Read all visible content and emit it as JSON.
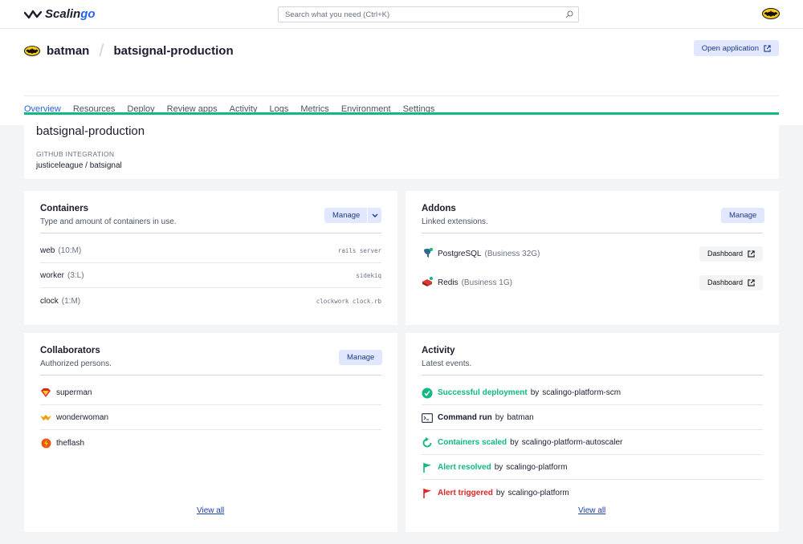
{
  "topbar": {
    "logo_text_a": "Scalin",
    "logo_text_b": "go",
    "search_placeholder": "Search what you need (Ctrl+K)"
  },
  "app": {
    "owner": "batman",
    "separator": "/",
    "name": "batsignal-production",
    "open_label": "Open application"
  },
  "nav": {
    "tabs": [
      "Overview",
      "Resources",
      "Deploy",
      "Review apps",
      "Activity",
      "Logs",
      "Metrics",
      "Environment",
      "Settings"
    ],
    "active": "Overview"
  },
  "hero": {
    "title": "batsignal-production",
    "integration_label": "GITHUB INTEGRATION",
    "integration_value": "justiceleague / batsignal"
  },
  "containers": {
    "title": "Containers",
    "subtitle": "Type and amount of containers in use.",
    "manage": "Manage",
    "rows": [
      {
        "name": "web",
        "size": "(10:M)",
        "cmd": "rails server"
      },
      {
        "name": "worker",
        "size": "(3:L)",
        "cmd": "sidekiq"
      },
      {
        "name": "clock",
        "size": "(1:M)",
        "cmd": "clockwork clock.rb"
      }
    ]
  },
  "addons": {
    "title": "Addons",
    "subtitle": "Linked extensions.",
    "manage": "Manage",
    "rows": [
      {
        "name": "PostgreSQL",
        "plan": "(Business 32G)",
        "action": "Dashboard",
        "icon": "postgresql-icon"
      },
      {
        "name": "Redis",
        "plan": "(Business 1G)",
        "action": "Dashboard",
        "icon": "redis-icon"
      }
    ]
  },
  "collaborators": {
    "title": "Collaborators",
    "subtitle": "Authorized persons.",
    "manage": "Manage",
    "rows": [
      {
        "name": "superman",
        "icon": "superman-avatar"
      },
      {
        "name": "wonderwoman",
        "icon": "wonderwoman-avatar"
      },
      {
        "name": "theflash",
        "icon": "theflash-avatar"
      }
    ],
    "view_all": "View all"
  },
  "activity": {
    "title": "Activity",
    "subtitle": "Latest events.",
    "rows": [
      {
        "event": "Successful deployment",
        "by": "by",
        "actor": "scalingo-platform-scm",
        "tone": "green",
        "icon": "check-circle-icon"
      },
      {
        "event": "Command run",
        "by": "by",
        "actor": "batman",
        "tone": "dark",
        "icon": "terminal-icon"
      },
      {
        "event": "Containers scaled",
        "by": "by",
        "actor": "scalingo-platform-autoscaler",
        "tone": "green",
        "icon": "refresh-icon"
      },
      {
        "event": "Alert resolved",
        "by": "by",
        "actor": "scalingo-platform",
        "tone": "green",
        "icon": "flag-icon"
      },
      {
        "event": "Alert triggered",
        "by": "by",
        "actor": "scalingo-platform",
        "tone": "red",
        "icon": "flag-icon"
      }
    ],
    "view_all": "View all"
  },
  "colors": {
    "accent": "#2563eb",
    "success": "#10b981",
    "danger": "#dc2626",
    "button_bg": "#e0e7ff"
  }
}
